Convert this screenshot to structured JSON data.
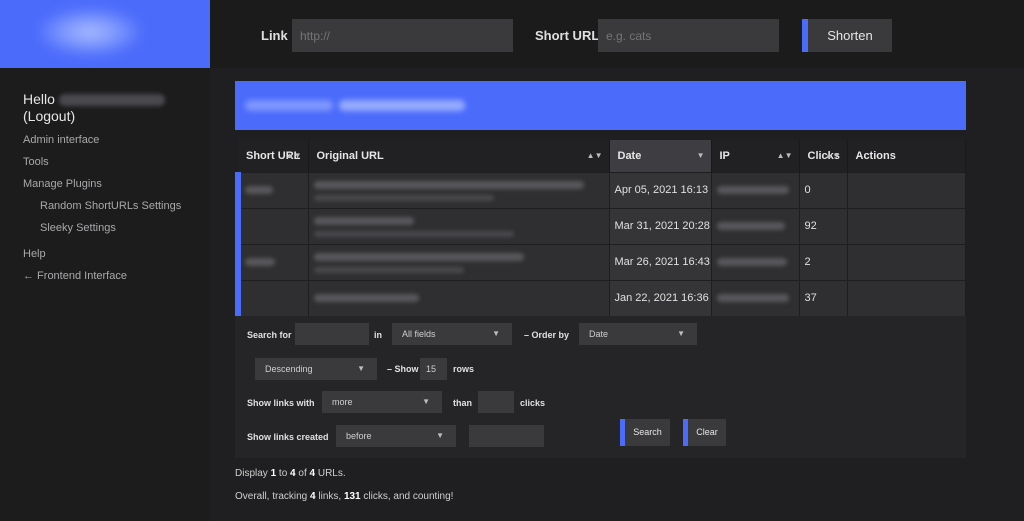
{
  "sidebar": {
    "hello": "Hello",
    "logout": "(Logout)",
    "items": [
      {
        "label": "Admin interface"
      },
      {
        "label": "Tools"
      },
      {
        "label": "Manage Plugins"
      },
      {
        "label": "Random ShortURLs Settings"
      },
      {
        "label": "Sleeky Settings"
      },
      {
        "label": "Help"
      },
      {
        "label": "← Frontend Interface"
      }
    ]
  },
  "topbar": {
    "link_label": "Link",
    "link_placeholder": "http://",
    "short_label": "Short URL",
    "short_placeholder": "e.g. cats",
    "shorten_label": "Shorten"
  },
  "table": {
    "headers": [
      "Short URL",
      "Original URL",
      "Date",
      "IP",
      "Clicks",
      "Actions"
    ],
    "rows": [
      {
        "date": "Apr 05, 2021 16:13",
        "clicks": "0"
      },
      {
        "date": "Mar 31, 2021 20:28",
        "clicks": "92"
      },
      {
        "date": "Mar 26, 2021 16:43",
        "clicks": "2"
      },
      {
        "date": "Jan 22, 2021 16:36",
        "clicks": "37"
      }
    ]
  },
  "filters": {
    "search_for": "Search for",
    "in": "in",
    "all_fields": "All fields",
    "order_by": "– Order by",
    "order_field": "Date",
    "order_dir": "Descending",
    "show": "– Show",
    "rows_count": "15",
    "rows": "rows",
    "show_links_with": "Show links with",
    "more": "more",
    "than": "than",
    "clicks": "clicks",
    "show_links_created": "Show links created",
    "before": "before",
    "search_btn": "Search",
    "clear_btn": "Clear"
  },
  "info": {
    "display_prefix": "Display ",
    "display_from": "1",
    "display_to_word": " to ",
    "display_to": "4",
    "display_of_word": " of ",
    "display_total": "4",
    "display_suffix": " URLs.",
    "overall_prefix": "Overall, tracking ",
    "links": "4",
    "links_word": " links, ",
    "clicks": "131",
    "clicks_word": " clicks, and counting!"
  },
  "colors": {
    "accent": "#4b6bfb",
    "background": "#1f1f21"
  }
}
